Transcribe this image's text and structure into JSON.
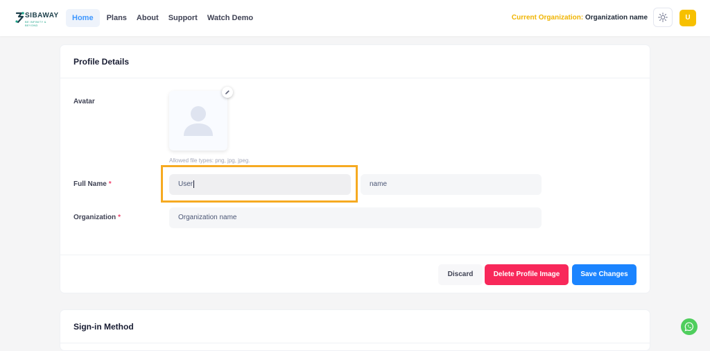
{
  "brand": {
    "name": "SIBAWAY",
    "tagline": "BE INFINITY & BEYOND"
  },
  "nav": {
    "items": [
      {
        "label": "Home",
        "active": true
      },
      {
        "label": "Plans"
      },
      {
        "label": "About"
      },
      {
        "label": "Support"
      },
      {
        "label": "Watch Demo"
      }
    ]
  },
  "header": {
    "org_prefix": "Current Organization:",
    "org_name": "Organization name",
    "user_initial": "U",
    "theme_icon": "sun-icon"
  },
  "profile": {
    "title": "Profile Details",
    "avatar_label": "Avatar",
    "allowed_types": "Allowed file types: png, jpg, jpeg.",
    "full_name_label": "Full Name",
    "first_name_value": "User",
    "last_name_value": "name",
    "organization_label": "Organization",
    "organization_value": "Organization name",
    "required_mark": "*"
  },
  "actions": {
    "discard": "Discard",
    "delete": "Delete Profile Image",
    "save": "Save Changes"
  },
  "signin": {
    "title": "Sign-in Method"
  },
  "colors": {
    "accent": "#1b84ff",
    "danger": "#f8285a",
    "highlight": "#f6aa21",
    "org_label": "#f0b400",
    "whatsapp": "#4fce5d"
  }
}
